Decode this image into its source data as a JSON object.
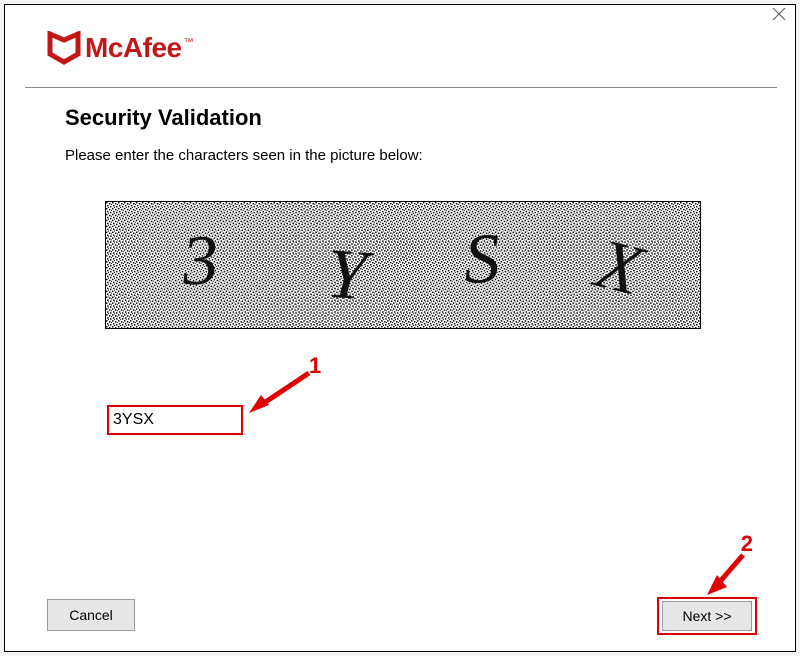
{
  "brand": {
    "name": "McAfee",
    "tm": "™",
    "color": "#c01818"
  },
  "dialog": {
    "heading": "Security Validation",
    "instruction": "Please enter the characters seen in the picture below:",
    "captcha_text": "3YSX",
    "input_value": "3YSX"
  },
  "buttons": {
    "cancel": "Cancel",
    "next": "Next >>"
  },
  "annotations": {
    "step1": "1",
    "step2": "2",
    "highlight_color": "#e00000"
  }
}
